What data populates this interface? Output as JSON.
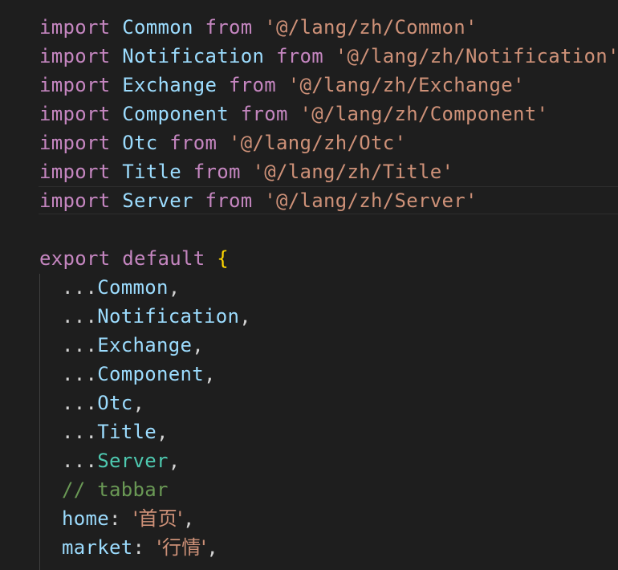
{
  "imports": [
    {
      "kw": "import",
      "name": "Common",
      "from": "from",
      "path": "'@/lang/zh/Common'"
    },
    {
      "kw": "import",
      "name": "Notification",
      "from": "from",
      "path": "'@/lang/zh/Notification'"
    },
    {
      "kw": "import",
      "name": "Exchange",
      "from": "from",
      "path": "'@/lang/zh/Exchange'"
    },
    {
      "kw": "import",
      "name": "Component",
      "from": "from",
      "path": "'@/lang/zh/Component'"
    },
    {
      "kw": "import",
      "name": "Otc",
      "from": "from",
      "path": "'@/lang/zh/Otc'"
    },
    {
      "kw": "import",
      "name": "Title",
      "from": "from",
      "path": "'@/lang/zh/Title'"
    },
    {
      "kw": "import",
      "name": "Server",
      "from": "from",
      "path": "'@/lang/zh/Server'"
    }
  ],
  "export_line": {
    "kw1": "export",
    "kw2": "default",
    "brace": "{"
  },
  "spreads": [
    {
      "dots": "...",
      "name": "Common",
      "comma": ","
    },
    {
      "dots": "...",
      "name": "Notification",
      "comma": ","
    },
    {
      "dots": "...",
      "name": "Exchange",
      "comma": ","
    },
    {
      "dots": "...",
      "name": "Component",
      "comma": ","
    },
    {
      "dots": "...",
      "name": "Otc",
      "comma": ","
    },
    {
      "dots": "...",
      "name": "Title",
      "comma": ","
    },
    {
      "dots": "...",
      "name": "Server",
      "comma": ","
    }
  ],
  "comment": "// tabbar",
  "props": [
    {
      "key": "home",
      "colon": ":",
      "value": "'首页'",
      "comma": ","
    },
    {
      "key": "market",
      "colon": ":",
      "value": "'行情'",
      "comma": ","
    }
  ],
  "colors": {
    "background": "#1e1e1e",
    "keyword": "#c586c0",
    "identifier": "#9cdcfe",
    "string": "#ce9178",
    "class": "#4ec9b0",
    "comment": "#6a9955",
    "punctuation": "#d4d4d4",
    "bracket": "#ffd700"
  }
}
